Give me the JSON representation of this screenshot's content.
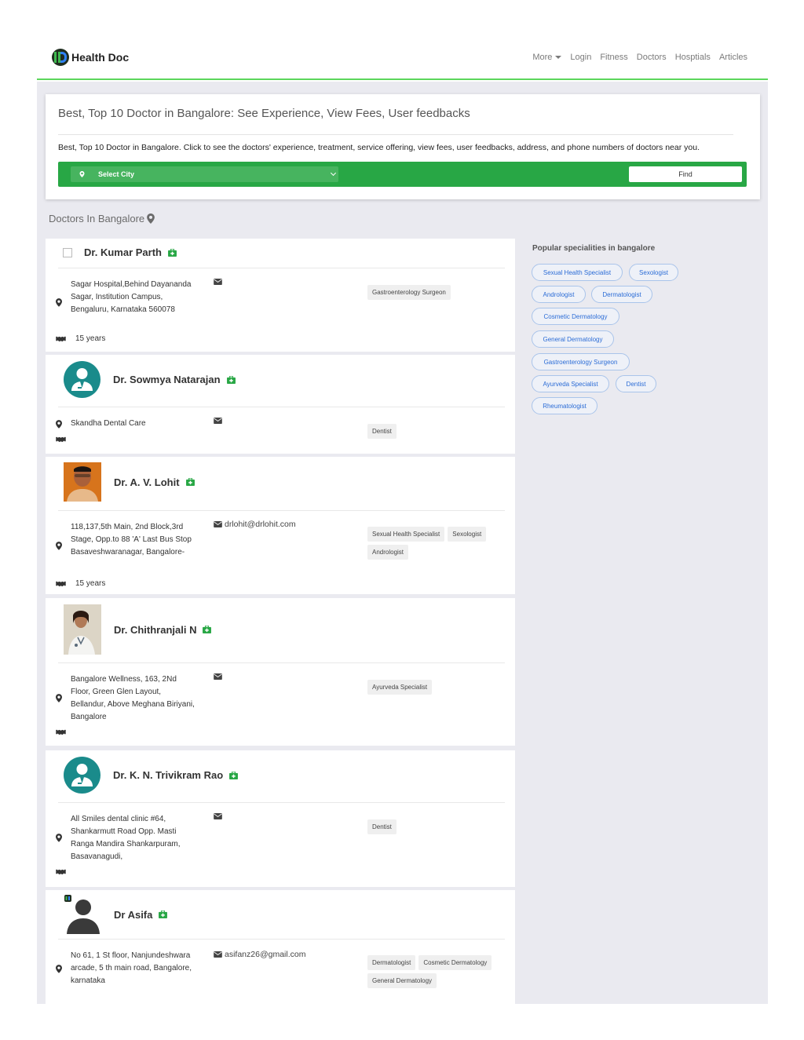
{
  "brand": {
    "name": "Health Doc"
  },
  "nav": {
    "more": "More",
    "login": "Login",
    "fitness": "Fitness",
    "doctors": "Doctors",
    "hospitals": "Hosptials",
    "articles": "Articles"
  },
  "hero": {
    "title": "Best, Top 10 Doctor in Bangalore: See Experience, View Fees, User feedbacks",
    "description": "Best, Top 10 Doctor in Bangalore. Click to see the doctors' experience, treatment, service offering, view fees, user feedbacks, address, and phone numbers of doctors near you.",
    "city_select": "Select City",
    "find": "Find"
  },
  "section_title": "Doctors In Bangalore",
  "doctors": [
    {
      "name": "Dr. Kumar Parth",
      "address": "Sagar Hospital,Behind Dayananda Sagar, Institution Campus, Bengaluru, Karnataka 560078",
      "email": "",
      "experience": "15 years",
      "tags": [
        "Gastroenterology Surgeon"
      ]
    },
    {
      "name": "Dr. Sowmya Natarajan",
      "address": "Skandha Dental Care",
      "email": "",
      "experience": "",
      "tags": [
        "Dentist"
      ]
    },
    {
      "name": "Dr. A. V. Lohit",
      "address": "118,137,5th Main, 2nd Block,3rd Stage, Opp.to 88 'A' Last Bus Stop Basaveshwaranagar, Bangalore-",
      "email": "drlohit@drlohit.com",
      "experience": "15 years",
      "tags": [
        "Sexual Health Specialist",
        "Sexologist",
        "Andrologist"
      ]
    },
    {
      "name": "Dr. Chithranjali N",
      "address": "Bangalore Wellness, 163, 2Nd Floor, Green Glen Layout, Bellandur, Above Meghana Biriyani, Bangalore",
      "email": "",
      "experience": "",
      "tags": [
        "Ayurveda Specialist"
      ]
    },
    {
      "name": "Dr. K. N. Trivikram Rao",
      "address": "All Smiles dental clinic #64, Shankarmutt Road Opp. Masti Ranga Mandira Shankarpuram, Basavanagudi,",
      "email": "",
      "experience": "",
      "tags": [
        "Dentist"
      ]
    },
    {
      "name": "Dr Asifa",
      "address": "No 61, 1 St floor, Nanjundeshwara arcade, 5 th main road, Bangalore, karnataka",
      "email": "asifanz26@gmail.com",
      "experience": "",
      "tags": [
        "Dermatologist",
        "Cosmetic Dermatology",
        "General Dermatology"
      ]
    }
  ],
  "sidebar": {
    "title": "Popular specialities in bangalore",
    "specialities": [
      "Sexual Health Specialist",
      "Sexologist",
      "Andrologist",
      "Dermatologist",
      "Cosmetic Dermatology",
      "General Dermatology",
      "Gastroenterology Surgeon",
      "Ayurveda Specialist",
      "Dentist",
      "Rheumatologist"
    ]
  },
  "colors": {
    "accent": "#28a745",
    "nav_border": "#5cd65c",
    "link": "#2b6cd6",
    "avatar": "#1a8b8b",
    "background": "#eaeaf0"
  }
}
